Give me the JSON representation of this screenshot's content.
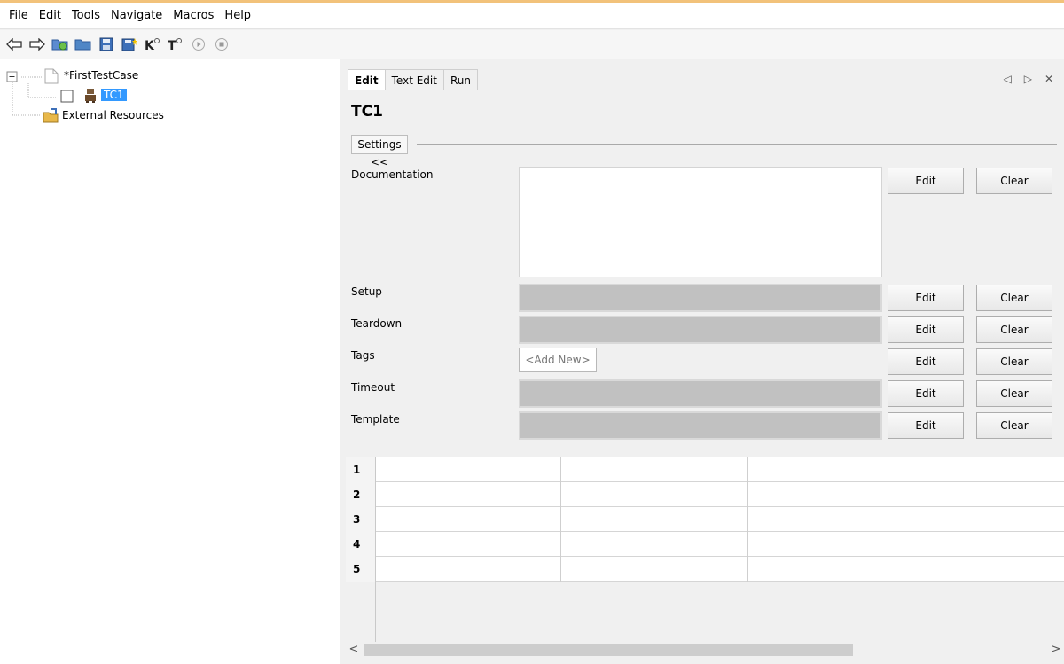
{
  "menu": [
    "File",
    "Edit",
    "Tools",
    "Navigate",
    "Macros",
    "Help"
  ],
  "toolbar_icons": [
    "back-arrow-icon",
    "forward-arrow-icon",
    "open-folder-refresh-icon",
    "open-folder-icon",
    "save-icon",
    "save-all-icon",
    "keyword-search-icon",
    "test-search-icon",
    "run-icon",
    "stop-icon"
  ],
  "tree": {
    "root": "*FirstTestCase",
    "child": "TC1",
    "resources": "External Resources"
  },
  "tabs": [
    "Edit",
    "Text Edit",
    "Run"
  ],
  "tab_controls": [
    "◁",
    "▷",
    "✕"
  ],
  "editor": {
    "title": "TC1",
    "settings_label": "Settings <<",
    "documentation_label": "Documentation",
    "setup_label": "Setup",
    "teardown_label": "Teardown",
    "tags_label": "Tags",
    "timeout_label": "Timeout",
    "template_label": "Template",
    "tags_placeholder": "<Add New>",
    "edit_label": "Edit",
    "clear_label": "Clear"
  },
  "grid": {
    "rows": [
      "1",
      "2",
      "3",
      "4",
      "5"
    ]
  },
  "scroll": {
    "left": "<",
    "right": ">"
  }
}
